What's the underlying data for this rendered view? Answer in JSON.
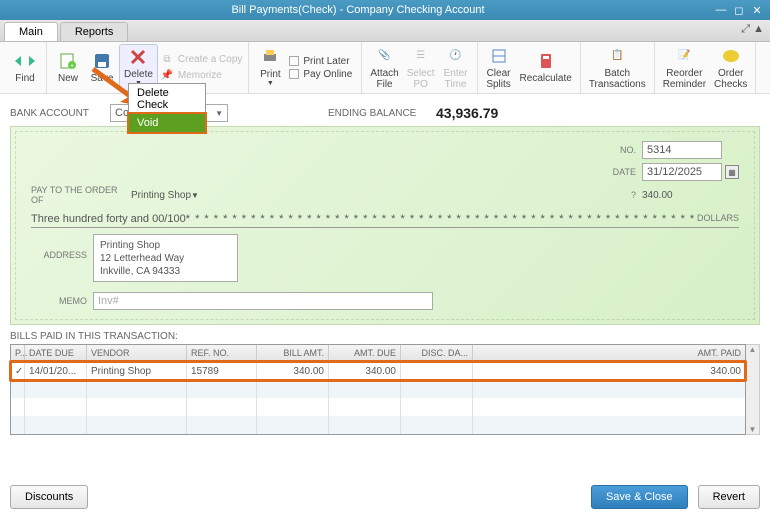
{
  "window": {
    "title": "Bill Payments(Check) - Company Checking Account"
  },
  "tabs": {
    "main": "Main",
    "reports": "Reports"
  },
  "toolbar": {
    "find": "Find",
    "new": "New",
    "save": "Save",
    "delete": "Delete",
    "create_copy": "Create a Copy",
    "memorize": "Memorize",
    "print": "Print",
    "print_later": "Print Later",
    "pay_online": "Pay Online",
    "attach_file": "Attach\nFile",
    "select_po": "Select\nPO",
    "enter_time": "Enter\nTime",
    "clear_splits": "Clear\nSplits",
    "recalculate": "Recalculate",
    "batch_trans": "Batch\nTransactions",
    "reorder_reminder": "Reorder\nReminder",
    "order_checks": "Order\nChecks"
  },
  "delete_menu": {
    "delete_check": "Delete Check",
    "void": "Void"
  },
  "account": {
    "bank_account_label": "BANK ACCOUNT",
    "bank_account_value": "Compa",
    "bank_account_suffix": "unt",
    "ending_balance_label": "ENDING BALANCE",
    "ending_balance_value": "43,936.79"
  },
  "check": {
    "no_label": "NO.",
    "no_value": "5314",
    "date_label": "DATE",
    "date_value": "31/12/2025",
    "amount_q": "?",
    "amount_value": "340.00",
    "payto_label": "PAY TO THE ORDER OF",
    "payto_value": "Printing Shop",
    "amount_words": "Three hundred forty and 00/100",
    "dollars_label": "DOLLARS",
    "address_label": "ADDRESS",
    "address_line1": "Printing Shop",
    "address_line2": "12 Letterhead Way",
    "address_line3": "Inkville, CA 94333",
    "memo_label": "MEMO",
    "memo_placeholder": "Inv#"
  },
  "grid": {
    "title": "BILLS PAID IN THIS TRANSACTION:",
    "cols": {
      "p": "P...",
      "date_due": "DATE DUE",
      "vendor": "VENDOR",
      "ref_no": "REF. NO.",
      "bill_amt": "BILL AMT.",
      "amt_due": "AMT. DUE",
      "disc_da": "DISC. DA...",
      "amt_paid": "AMT. PAID"
    },
    "rows": [
      {
        "p": "✓",
        "date_due": "14/01/20...",
        "vendor": "Printing Shop",
        "ref_no": "15789",
        "bill_amt": "340.00",
        "amt_due": "340.00",
        "disc_da": "",
        "amt_paid": "340.00"
      }
    ]
  },
  "footer": {
    "discounts": "Discounts",
    "save_close": "Save & Close",
    "revert": "Revert"
  },
  "colors": {
    "accent_orange": "#e06a1a",
    "highlight_green": "#5da020"
  }
}
